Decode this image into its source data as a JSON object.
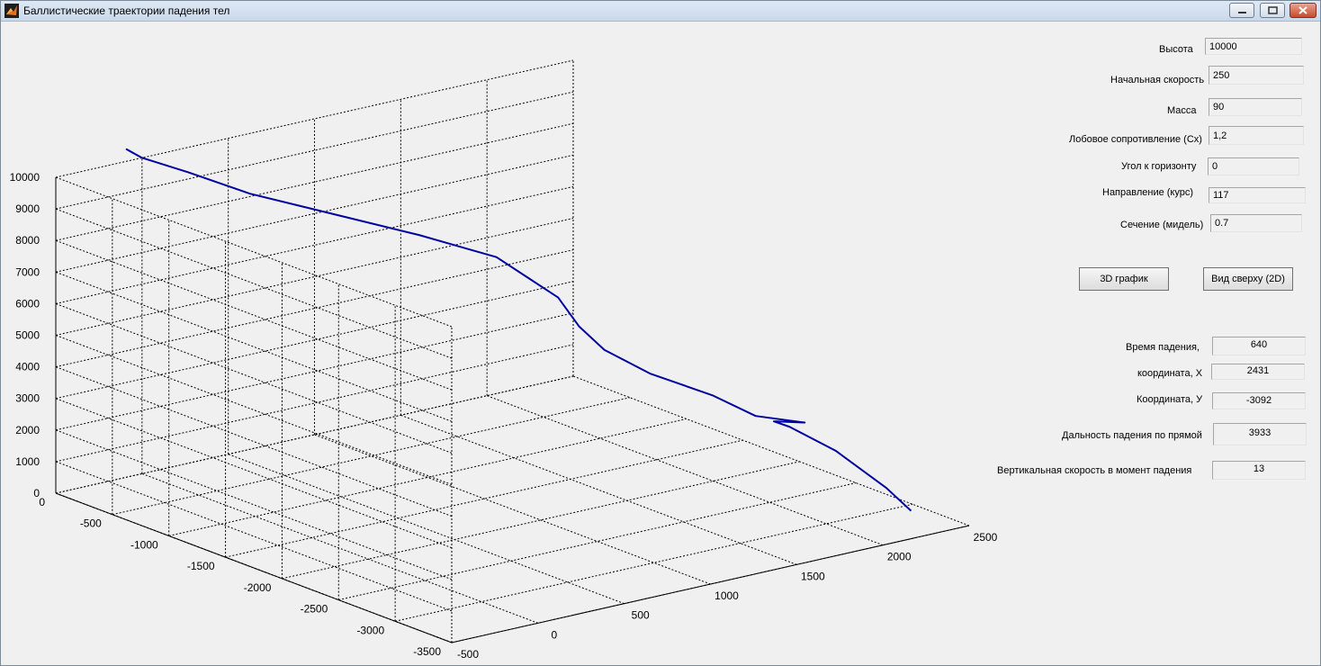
{
  "window": {
    "title": "Баллистические траектории падения тел"
  },
  "inputs": {
    "height": {
      "label": "Высота",
      "value": "10000"
    },
    "initial_speed": {
      "label": "Начальная скорость",
      "value": "250"
    },
    "mass": {
      "label": "Масса",
      "value": "90"
    },
    "drag": {
      "label": "Лобовое сопротивление (Cx)",
      "value": "1,2"
    },
    "angle": {
      "label": "Угол к горизонту",
      "value": "0"
    },
    "heading": {
      "label": "Направление  (курс)",
      "value": "117"
    },
    "section": {
      "label": "Сечение (мидель)",
      "value": "0.7"
    }
  },
  "buttons": {
    "plot3d": "3D график",
    "top2d": "Вид сверху (2D)"
  },
  "outputs": {
    "fall_time": {
      "label": "Время падения,",
      "value": "640"
    },
    "coord_x": {
      "label": "координата, X",
      "value": "2431"
    },
    "coord_y": {
      "label": "Координата, У",
      "value": "-3092"
    },
    "range": {
      "label": "Дальность падения по прямой",
      "value": "3933"
    },
    "vspeed": {
      "label": "Вертикальная  скорость в момент падения",
      "value": "13"
    }
  },
  "chart_data": {
    "type": "line",
    "projection": "3d",
    "grid": true,
    "x_ticks": [
      "-500",
      "0",
      "500",
      "1000",
      "1500",
      "2000",
      "2500"
    ],
    "y_ticks": [
      "0",
      "-500",
      "-1000",
      "-1500",
      "-2000",
      "-2500",
      "-3000",
      "-3500"
    ],
    "z_ticks": [
      "0",
      "1000",
      "2000",
      "3000",
      "4000",
      "5000",
      "6000",
      "7000",
      "8000",
      "9000",
      "10000"
    ],
    "xlim": [
      -500,
      2500
    ],
    "ylim": [
      -3500,
      0
    ],
    "zlim": [
      0,
      10000
    ],
    "series": [
      {
        "color": "#0000a0",
        "points": [
          [
            0,
            0,
            10000
          ],
          [
            -30,
            40,
            10150
          ],
          [
            -50,
            60,
            10250
          ],
          [
            0,
            0,
            10000
          ],
          [
            150,
            -180,
            9600
          ],
          [
            350,
            -420,
            9000
          ],
          [
            500,
            -600,
            8700
          ],
          [
            700,
            -840,
            8300
          ],
          [
            900,
            -1080,
            7900
          ],
          [
            1150,
            -1380,
            7300
          ],
          [
            1250,
            -1500,
            6700
          ],
          [
            1350,
            -1620,
            6100
          ],
          [
            1420,
            -1700,
            5200
          ],
          [
            1500,
            -1800,
            4500
          ],
          [
            1650,
            -1980,
            3800
          ],
          [
            1850,
            -2220,
            3200
          ],
          [
            1990,
            -2390,
            2600
          ],
          [
            2150,
            -2580,
            2450
          ],
          [
            2050,
            -2460,
            2450
          ],
          [
            2100,
            -2520,
            2300
          ],
          [
            2250,
            -2700,
            1600
          ],
          [
            2380,
            -2950,
            600
          ],
          [
            2431,
            -3092,
            0
          ]
        ]
      }
    ]
  }
}
